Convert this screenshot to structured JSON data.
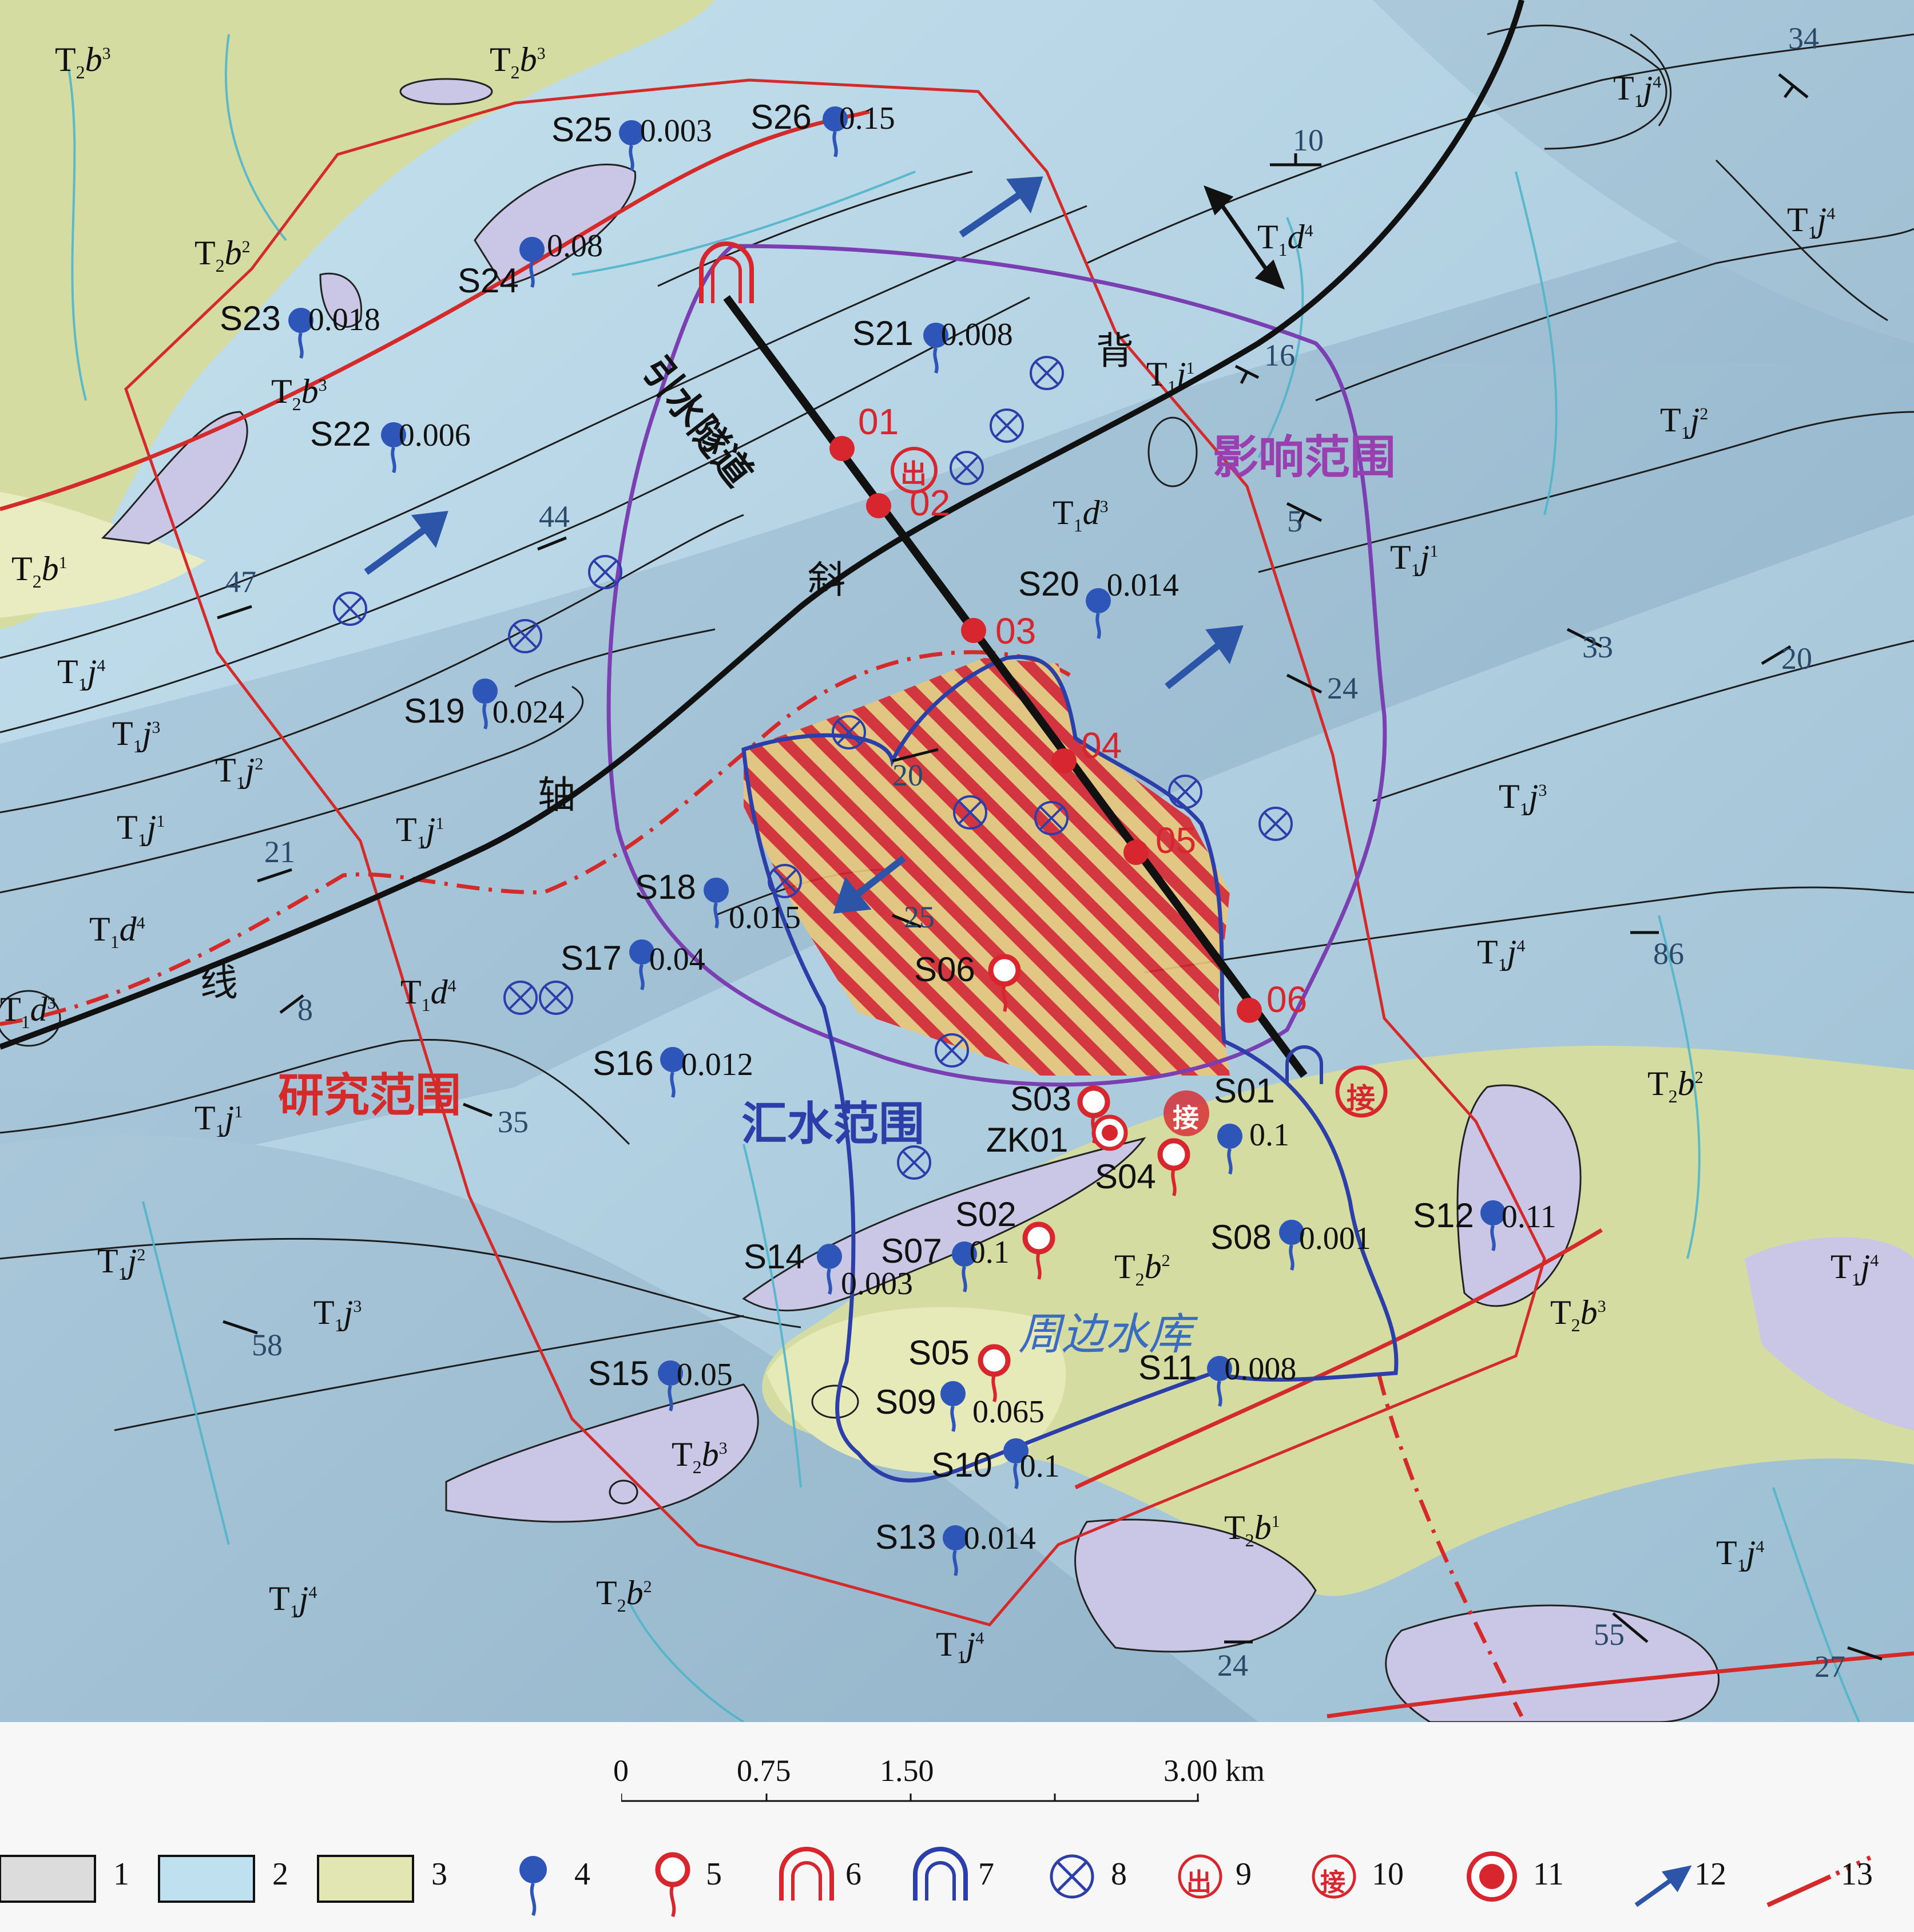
{
  "map": {
    "outline_labels": {
      "study_area": "研究范围",
      "influence_area": "影响范围",
      "catchment_area": "汇水范围",
      "reservoir": "周边水库",
      "tunnel": "引水隧道",
      "anticline_chars": [
        "背",
        "斜",
        "轴",
        "线"
      ]
    },
    "tunnel_points": [
      "01",
      "02",
      "03",
      "04",
      "05",
      "06"
    ],
    "springs": [
      {
        "id": "S25",
        "value": "0.003"
      },
      {
        "id": "S26",
        "value": "0.15"
      },
      {
        "id": "S24",
        "value": "0.08"
      },
      {
        "id": "S23",
        "value": "0.018"
      },
      {
        "id": "S22",
        "value": "0.006"
      },
      {
        "id": "S21",
        "value": "0.008"
      },
      {
        "id": "S20",
        "value": "0.014"
      },
      {
        "id": "S19",
        "value": "0.024"
      },
      {
        "id": "S18",
        "value": "0.015"
      },
      {
        "id": "S17",
        "value": "0.04"
      },
      {
        "id": "S16",
        "value": "0.012"
      },
      {
        "id": "S01",
        "value": "0.1"
      },
      {
        "id": "S08",
        "value": "0.001"
      },
      {
        "id": "S12",
        "value": "0.11"
      },
      {
        "id": "S14",
        "value": "0.003"
      },
      {
        "id": "S07",
        "value": "0.1"
      },
      {
        "id": "S11",
        "value": "0.008"
      },
      {
        "id": "S15",
        "value": "0.05"
      },
      {
        "id": "S09",
        "value": "0.065"
      },
      {
        "id": "S10",
        "value": "0.1"
      },
      {
        "id": "S13",
        "value": "0.014"
      }
    ],
    "dry_points": [
      "S06",
      "S03",
      "S04",
      "S02",
      "S05"
    ],
    "borehole": "ZK01",
    "adit_chars": {
      "exit": "出",
      "connect": "接"
    },
    "strata_labels": [
      {
        "base": "T",
        "sub": "2",
        "letter": "b",
        "sup": "3"
      },
      {
        "base": "T",
        "sub": "2",
        "letter": "b",
        "sup": "3"
      },
      {
        "base": "T",
        "sub": "2",
        "letter": "b",
        "sup": "2"
      },
      {
        "base": "T",
        "sub": "2",
        "letter": "b",
        "sup": "3"
      },
      {
        "base": "T",
        "sub": "2",
        "letter": "b",
        "sup": "1"
      },
      {
        "base": "T",
        "sub": "1",
        "letter": "j",
        "sup": "4"
      },
      {
        "base": "T",
        "sub": "1",
        "letter": "j",
        "sup": "3"
      },
      {
        "base": "T",
        "sub": "1",
        "letter": "j",
        "sup": "2"
      },
      {
        "base": "T",
        "sub": "1",
        "letter": "j",
        "sup": "1"
      },
      {
        "base": "T",
        "sub": "1",
        "letter": "d",
        "sup": "4"
      },
      {
        "base": "T",
        "sub": "1",
        "letter": "d",
        "sup": "3"
      },
      {
        "base": "T",
        "sub": "1",
        "letter": "j",
        "sup": "1"
      },
      {
        "base": "T",
        "sub": "1",
        "letter": "d",
        "sup": "4"
      },
      {
        "base": "T",
        "sub": "1",
        "letter": "j",
        "sup": "1"
      },
      {
        "base": "T",
        "sub": "1",
        "letter": "j",
        "sup": "2"
      },
      {
        "base": "T",
        "sub": "1",
        "letter": "j",
        "sup": "3"
      },
      {
        "base": "T",
        "sub": "1",
        "letter": "j",
        "sup": "1"
      },
      {
        "base": "T",
        "sub": "1",
        "letter": "d",
        "sup": "3"
      },
      {
        "base": "T",
        "sub": "1",
        "letter": "d",
        "sup": "4"
      },
      {
        "base": "T",
        "sub": "1",
        "letter": "j",
        "sup": "4"
      },
      {
        "base": "T",
        "sub": "1",
        "letter": "j",
        "sup": "4"
      },
      {
        "base": "T",
        "sub": "1",
        "letter": "j",
        "sup": "2"
      },
      {
        "base": "T",
        "sub": "1",
        "letter": "j",
        "sup": "1"
      },
      {
        "base": "T",
        "sub": "1",
        "letter": "j",
        "sup": "3"
      },
      {
        "base": "T",
        "sub": "1",
        "letter": "j",
        "sup": "4"
      },
      {
        "base": "T",
        "sub": "2",
        "letter": "b",
        "sup": "2"
      },
      {
        "base": "T",
        "sub": "1",
        "letter": "j",
        "sup": "4"
      },
      {
        "base": "T",
        "sub": "2",
        "letter": "b",
        "sup": "3"
      },
      {
        "base": "T",
        "sub": "2",
        "letter": "b",
        "sup": "2"
      },
      {
        "base": "T",
        "sub": "2",
        "letter": "b",
        "sup": "3"
      },
      {
        "base": "T",
        "sub": "2",
        "letter": "b",
        "sup": "1"
      },
      {
        "base": "T",
        "sub": "2",
        "letter": "b",
        "sup": "2"
      },
      {
        "base": "T",
        "sub": "1",
        "letter": "j",
        "sup": "4"
      },
      {
        "base": "T",
        "sub": "1",
        "letter": "j",
        "sup": "4"
      },
      {
        "base": "T",
        "sub": "1",
        "letter": "j",
        "sup": "4"
      }
    ],
    "dip_angles": [
      "34",
      "10",
      "16",
      "5",
      "33",
      "20",
      "24",
      "44",
      "47",
      "21",
      "8",
      "35",
      "58",
      "20",
      "25",
      "86",
      "55",
      "24",
      "27"
    ]
  },
  "scale_bar": {
    "ticks": [
      "0",
      "0.75",
      "1.50",
      "3.00 km"
    ]
  },
  "legend": {
    "items": [
      "1",
      "2",
      "3",
      "4",
      "5",
      "6",
      "7",
      "8",
      "9",
      "10",
      "11",
      "12",
      "13"
    ]
  },
  "colors": {
    "limestone": "#bfe0ee",
    "sandstone": "#e2e6b2",
    "mudstone": "#c9c6e6",
    "study_boundary": "#d52a2a",
    "influence_boundary": "#7a3fb0",
    "catchment_boundary": "#2c3ea8",
    "spring_blue": "#2e55b8",
    "dry_red": "#d7262e",
    "river": "#4fb5c9"
  }
}
